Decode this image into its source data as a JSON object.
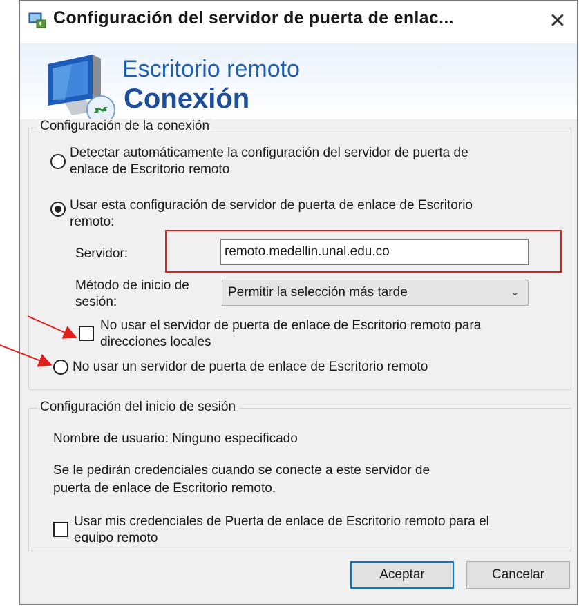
{
  "window": {
    "title": "Configuración del servidor de puerta de enlac...",
    "close_label": "✕"
  },
  "banner": {
    "line1": "Escritorio remoto",
    "line2": "Conexión"
  },
  "connection": {
    "legend": "Configuración de la conexión",
    "option_auto_line1": "Detectar automáticamente la configuración del servidor de puerta de",
    "option_auto_line2": "enlace de Escritorio remoto",
    "option_auto_selected": false,
    "option_use_line1": "Usar esta configuración de servidor de puerta de enlace de Escritorio",
    "option_use_line2": "remoto:",
    "option_use_selected": true,
    "server_label": "Servidor:",
    "server_value": "remoto.medellin.unal.edu.co",
    "method_label_line1": "Método de inicio de",
    "method_label_line2": "sesión:",
    "method_value": "Permitir la selección más tarde",
    "bypass_line1": "No usar el servidor de puerta de enlace de Escritorio remoto para",
    "bypass_line2": "direcciones locales",
    "bypass_checked": false,
    "option_none": "No usar un servidor de puerta de enlace de Escritorio remoto",
    "option_none_selected": false
  },
  "logon": {
    "legend": "Configuración del inicio de sesión",
    "username_text": "Nombre de usuario: Ninguno especificado",
    "prompt_line1": "Se le pedirán credenciales cuando se conecte a este servidor de",
    "prompt_line2": "puerta de enlace de Escritorio remoto.",
    "use_creds_line1": "Usar mis credenciales de Puerta de enlace de Escritorio remoto para el",
    "use_creds_line2": "equipo remoto",
    "use_creds_checked": false
  },
  "buttons": {
    "ok": "Aceptar",
    "cancel": "Cancelar"
  },
  "colors": {
    "annotation_red": "#e0201c",
    "accent_blue": "#0078d7"
  }
}
